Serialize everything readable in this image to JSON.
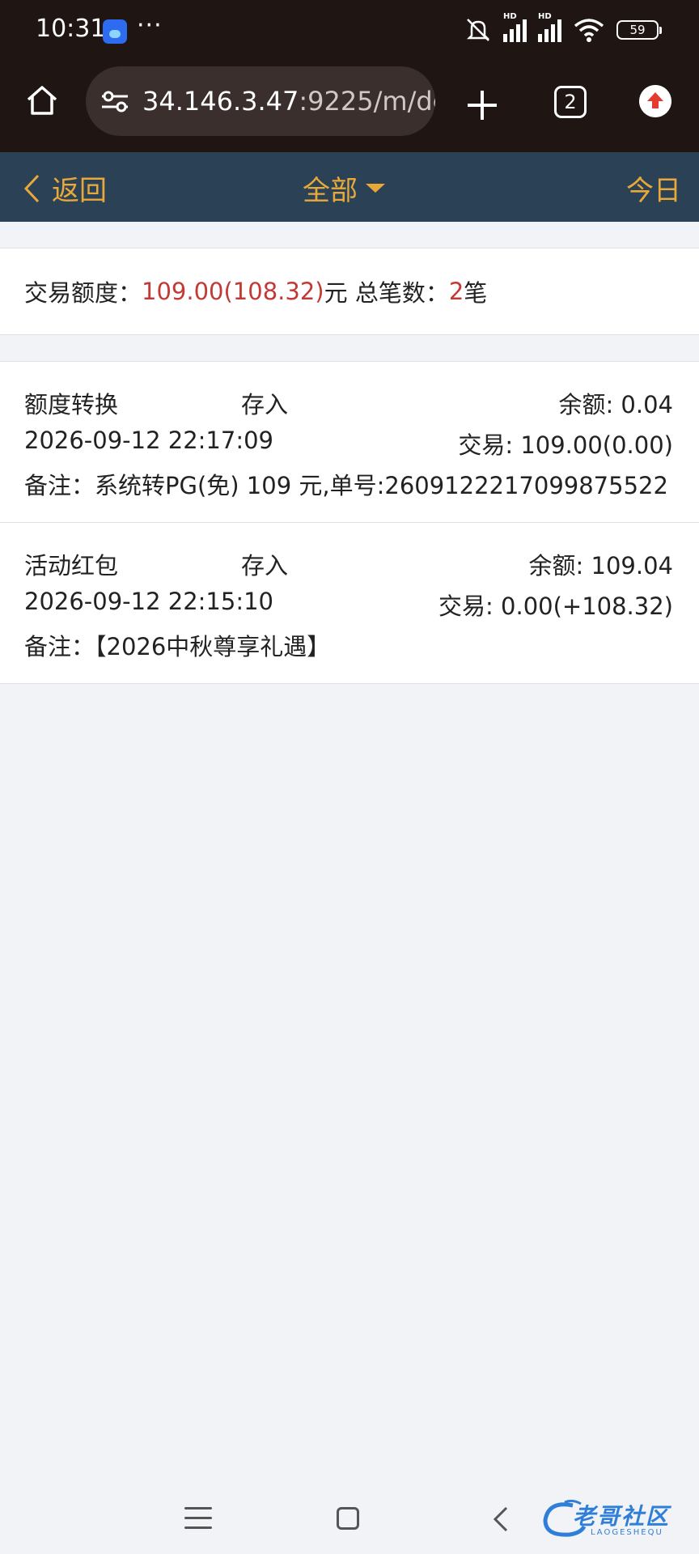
{
  "status_bar": {
    "time": "10:31",
    "app_icon": "car-forum-app-icon",
    "more": "···",
    "signal_label_1": "HD",
    "signal_label_2": "HD",
    "battery": "59"
  },
  "browser": {
    "url_host": "34.146.3.47",
    "url_rest": ":9225/m/de",
    "tab_count": "2",
    "icons": [
      "home-icon",
      "site-settings-icon",
      "new-tab-icon",
      "tab-switcher-icon",
      "update-icon"
    ]
  },
  "nav": {
    "back_label": "返回",
    "filter_label": "全部",
    "today_label": "今日",
    "accent_color": "#e8a93a",
    "bar_color": "#2b4156"
  },
  "summary": {
    "amount_label": "交易额度：",
    "amount_value": "109.00(108.32)",
    "amount_unit": "元",
    "count_label": " 总笔数：",
    "count_value": "2",
    "count_unit": "笔",
    "highlight_color": "#c23a36"
  },
  "records": [
    {
      "category": "额度转换",
      "direction": "存入",
      "balance": "余额: 0.04",
      "time": "2026-09-12 22:17:09",
      "trade": "交易: 109.00(0.00)",
      "note": "备注：系统转PG(免) 109 元,单号:2609122217099875522"
    },
    {
      "category": "活动红包",
      "direction": "存入",
      "balance": "余额: 109.04",
      "time": "2026-09-12 22:15:10",
      "trade": "交易: 0.00(+108.32)",
      "note": "备注：【2026中秋尊享礼遇】"
    }
  ],
  "watermark": {
    "text": "老哥社区",
    "sub": "LAOGESHEQU"
  }
}
